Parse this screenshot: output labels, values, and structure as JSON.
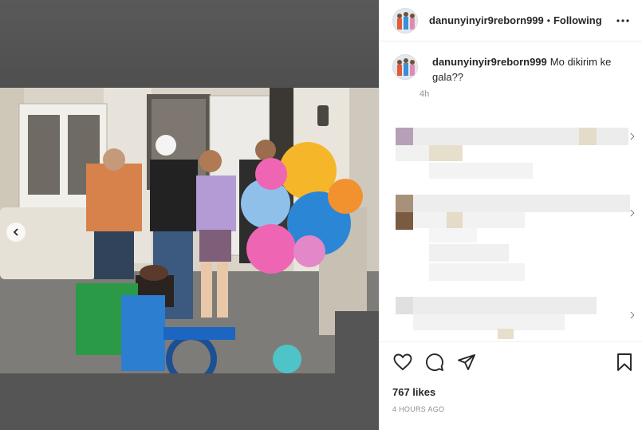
{
  "post": {
    "username": "danunyinyir9reborn999",
    "separator": "•",
    "follow_label": "Following",
    "caption_username": "danunyinyir9reborn999",
    "caption_text": "Mo dikirim ke gala??",
    "caption_age": "4h",
    "likes": "767 likes",
    "timestamp": "4 HOURS AGO"
  },
  "media": {
    "description_icon": "photo-image",
    "carousel_prev_icon": "chevron-left-icon"
  },
  "icons": {
    "more": "more-icon",
    "like": "heart-icon",
    "comment": "comment-icon",
    "share": "share-icon",
    "save": "bookmark-icon"
  },
  "colors": {
    "text": "#262626",
    "muted": "#8e8e8e",
    "border": "#efefef",
    "media_bg": "#515151"
  }
}
